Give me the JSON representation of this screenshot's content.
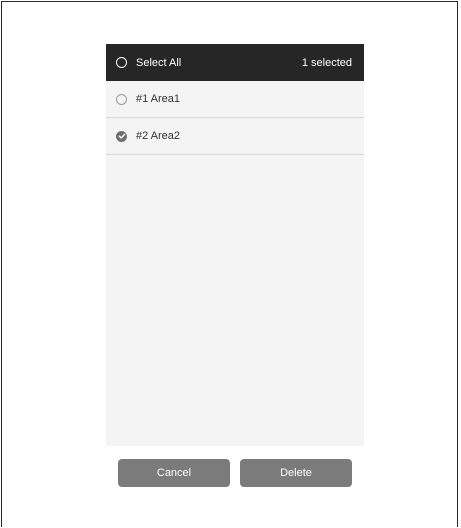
{
  "header": {
    "select_all_label": "Select All",
    "selected_count": "1 selected"
  },
  "list": {
    "items": [
      {
        "label": "#1 Area1",
        "checked": false
      },
      {
        "label": "#2 Area2",
        "checked": true
      }
    ]
  },
  "footer": {
    "cancel_label": "Cancel",
    "delete_label": "Delete"
  },
  "colors": {
    "header_bg": "#262626",
    "button_bg": "#7b7b7b",
    "list_bg": "#f4f4f4"
  }
}
